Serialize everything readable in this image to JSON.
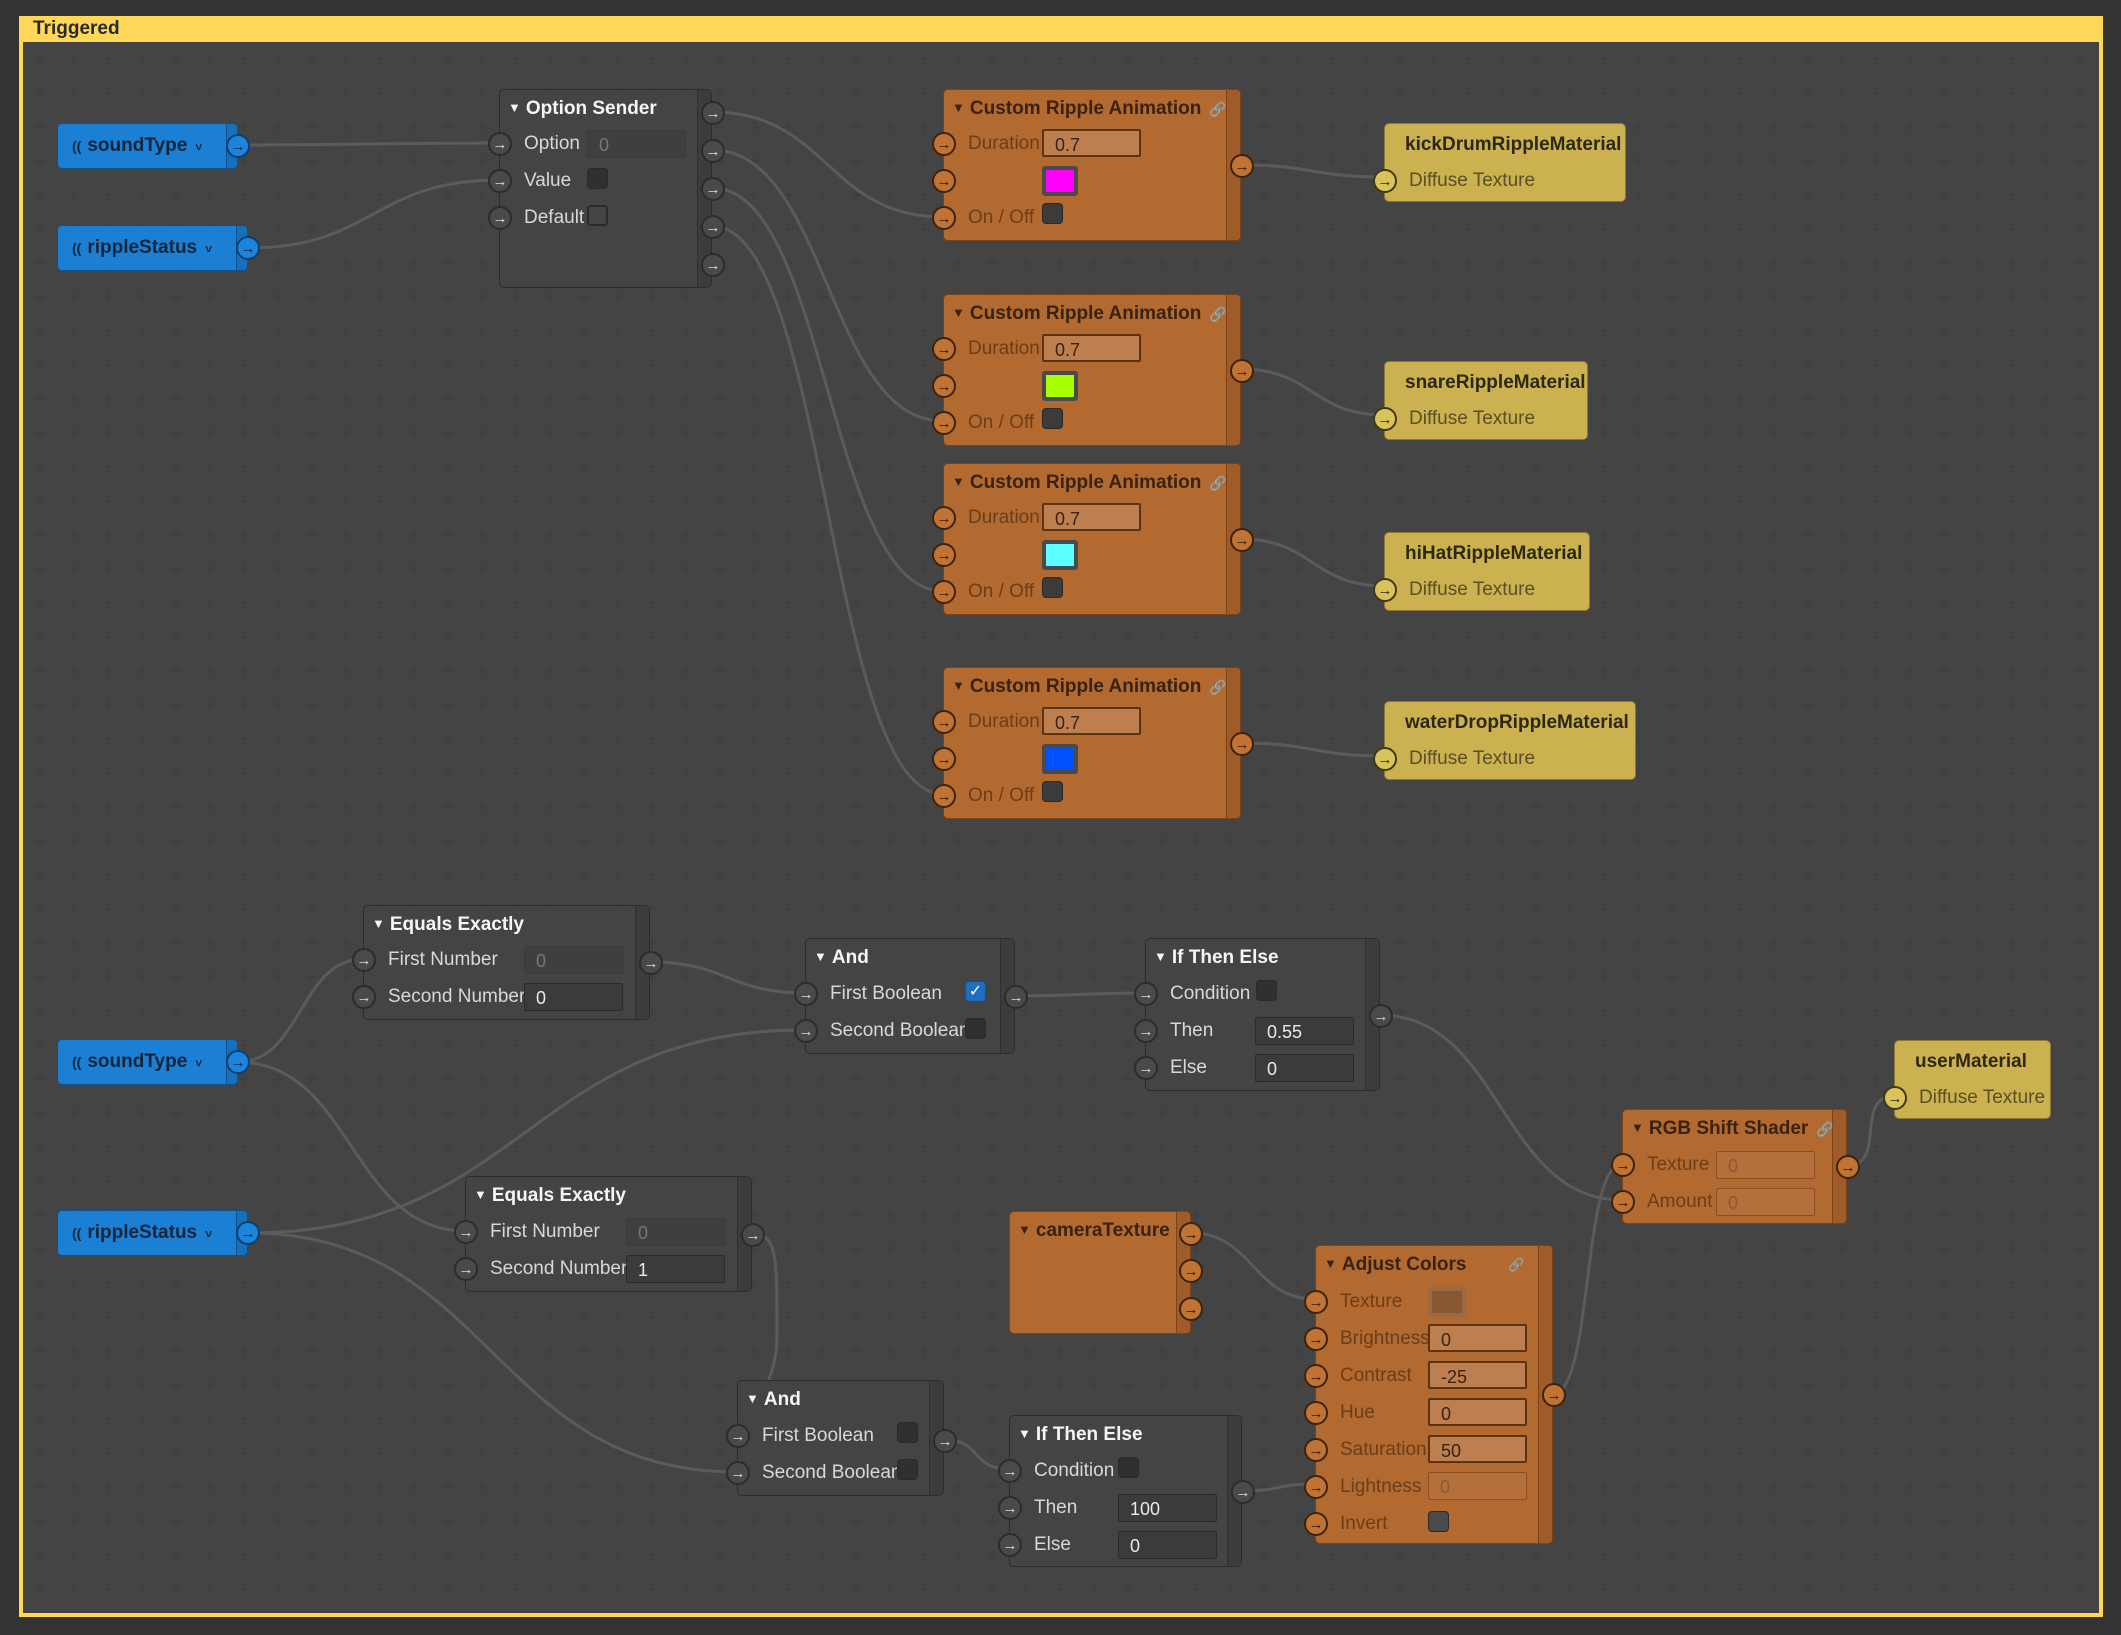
{
  "frame": {
    "title": "Triggered",
    "border_color": "#ffd85a"
  },
  "senders": [
    {
      "id": "soundType1",
      "label": "soundType",
      "icon": "broadcast-icon"
    },
    {
      "id": "rippleStatus1",
      "label": "rippleStatus",
      "icon": "broadcast-icon"
    },
    {
      "id": "soundType2",
      "label": "soundType",
      "icon": "broadcast-icon"
    },
    {
      "id": "rippleStatus2",
      "label": "rippleStatus",
      "icon": "broadcast-icon"
    }
  ],
  "option_sender": {
    "title": "Option Sender",
    "inputs": [
      {
        "label": "Option",
        "value": "0"
      },
      {
        "label": "Value",
        "checked": false
      },
      {
        "label": "Default",
        "checked": false
      }
    ],
    "output_count": 5
  },
  "ripples": [
    {
      "title": "Custom Ripple Animation",
      "duration_label": "Duration",
      "duration": "0.7",
      "color": "#ff00ff",
      "onoff_label": "On / Off"
    },
    {
      "title": "Custom Ripple Animation",
      "duration_label": "Duration",
      "duration": "0.7",
      "color": "#a8ff00",
      "onoff_label": "On / Off"
    },
    {
      "title": "Custom Ripple Animation",
      "duration_label": "Duration",
      "duration": "0.7",
      "color": "#5cffff",
      "onoff_label": "On / Off"
    },
    {
      "title": "Custom Ripple Animation",
      "duration_label": "Duration",
      "duration": "0.7",
      "color": "#0050ff",
      "onoff_label": "On / Off"
    }
  ],
  "materials": [
    {
      "title": "kickDrumRippleMaterial",
      "input": "Diffuse Texture"
    },
    {
      "title": "snareRippleMaterial",
      "input": "Diffuse Texture"
    },
    {
      "title": "hiHatRippleMaterial",
      "input": "Diffuse Texture"
    },
    {
      "title": "waterDropRippleMaterial",
      "input": "Diffuse Texture"
    },
    {
      "title": "userMaterial",
      "input": "Diffuse Texture"
    }
  ],
  "equals": [
    {
      "title": "Equals Exactly",
      "first_label": "First Number",
      "first_value": "0",
      "second_label": "Second Number",
      "second_value": "0"
    },
    {
      "title": "Equals Exactly",
      "first_label": "First Number",
      "first_value": "0",
      "second_label": "Second Number",
      "second_value": "1"
    }
  ],
  "ands": [
    {
      "title": "And",
      "first_label": "First Boolean",
      "first_checked": true,
      "second_label": "Second Boolean",
      "second_checked": false
    },
    {
      "title": "And",
      "first_label": "First Boolean",
      "first_checked": false,
      "second_label": "Second Boolean",
      "second_checked": false
    }
  ],
  "ifs": [
    {
      "title": "If Then Else",
      "condition_label": "Condition",
      "then_label": "Then",
      "then_value": "0.55",
      "else_label": "Else",
      "else_value": "0"
    },
    {
      "title": "If Then Else",
      "condition_label": "Condition",
      "then_label": "Then",
      "then_value": "100",
      "else_label": "Else",
      "else_value": "0"
    }
  ],
  "camera": {
    "title": "cameraTexture"
  },
  "adjust": {
    "title": "Adjust Colors",
    "rows": [
      {
        "label": "Texture",
        "type": "texture"
      },
      {
        "label": "Brightness",
        "value": "0"
      },
      {
        "label": "Contrast",
        "value": "-25"
      },
      {
        "label": "Hue",
        "value": "0"
      },
      {
        "label": "Saturation",
        "value": "50"
      },
      {
        "label": "Lightness",
        "value": "0",
        "dim": true
      },
      {
        "label": "Invert",
        "type": "check"
      }
    ]
  },
  "rgb": {
    "title": "RGB Shift Shader",
    "texture_label": "Texture",
    "texture_value": "0",
    "amount_label": "Amount",
    "amount_value": "0"
  },
  "glyphs": {
    "arrow": "→",
    "triangle": "▼",
    "link": "🔗",
    "wave": "((",
    "chevron": "˅",
    "check": "✓"
  }
}
